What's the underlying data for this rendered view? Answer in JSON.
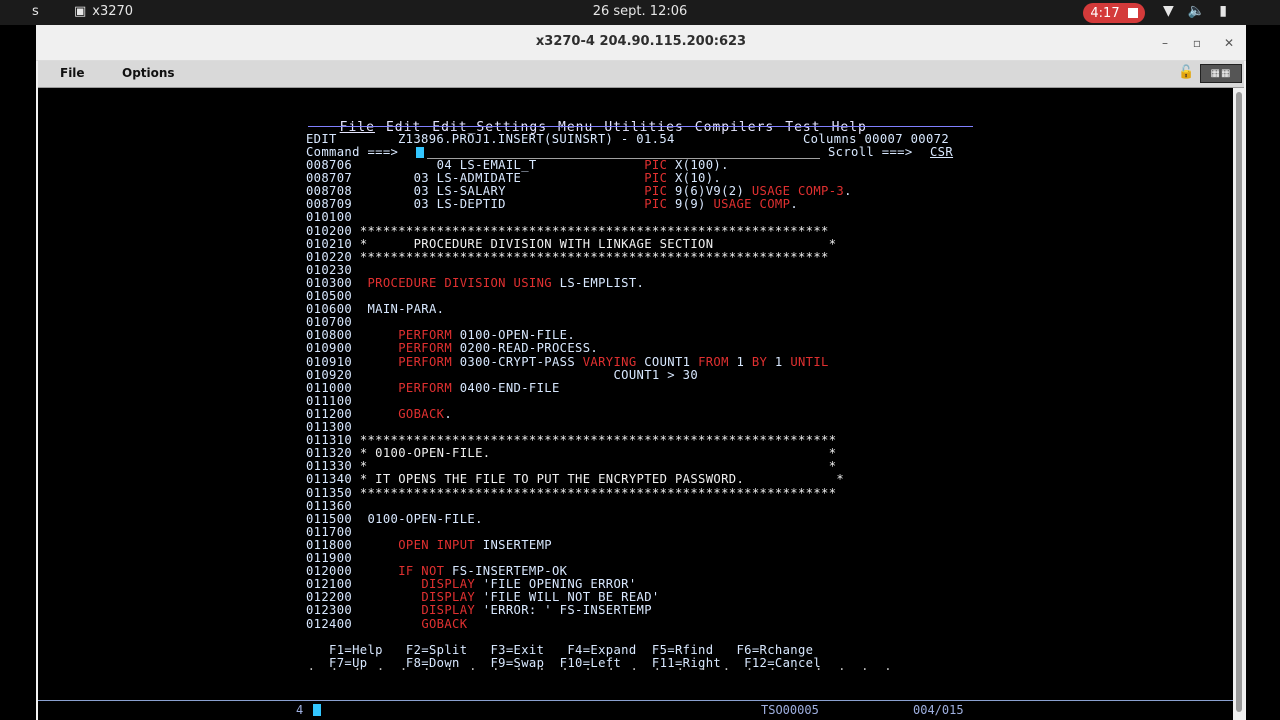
{
  "topbar": {
    "left_fragment": "s",
    "app_name": "x3270",
    "clock": "26 sept.  12:06",
    "recording_time": "4:17"
  },
  "window": {
    "title": "x3270-4 204.90.115.200:623",
    "menu": [
      "File",
      "Options"
    ]
  },
  "ispf": {
    "action_bar": [
      "File",
      "Edit",
      "Edit_Settings",
      "Menu",
      "Utilities",
      "Compilers",
      "Test",
      "Help"
    ],
    "header": {
      "mode": "EDIT",
      "dataset": "Z13896.PROJ1.INSERT(SUINSRT) - 01.54",
      "columns": "Columns 00007 00072"
    },
    "command": {
      "label": "Command ===>",
      "value": "",
      "scroll_label": "Scroll ===>",
      "scroll_value": "CSR"
    },
    "lines": [
      {
        "num": "008706",
        "segs": [
          {
            "t": "          04 LS-EMAIL_T              ",
            "c": "grn"
          },
          {
            "t": "PIC",
            "c": "red"
          },
          {
            "t": " X(100).",
            "c": "grn"
          }
        ]
      },
      {
        "num": "008707",
        "segs": [
          {
            "t": "       03 LS-ADMIDATE                ",
            "c": "grn"
          },
          {
            "t": "PIC",
            "c": "red"
          },
          {
            "t": " X(10).",
            "c": "grn"
          }
        ]
      },
      {
        "num": "008708",
        "segs": [
          {
            "t": "       03 LS-SALARY                  ",
            "c": "grn"
          },
          {
            "t": "PIC",
            "c": "red"
          },
          {
            "t": " 9(6)V9(2) ",
            "c": "grn"
          },
          {
            "t": "USAGE COMP-3",
            "c": "red"
          },
          {
            "t": ".",
            "c": "grn"
          }
        ]
      },
      {
        "num": "008709",
        "segs": [
          {
            "t": "       03 LS-DEPTID                  ",
            "c": "grn"
          },
          {
            "t": "PIC",
            "c": "red"
          },
          {
            "t": " 9(9) ",
            "c": "grn"
          },
          {
            "t": "USAGE COMP",
            "c": "red"
          },
          {
            "t": ".",
            "c": "grn"
          }
        ]
      },
      {
        "num": "010100",
        "segs": []
      },
      {
        "num": "010200",
        "segs": [
          {
            "t": "*************************************************************",
            "c": "wht"
          }
        ]
      },
      {
        "num": "010210",
        "segs": [
          {
            "t": "*      PROCEDURE DIVISION WITH LINKAGE SECTION               *",
            "c": "wht"
          }
        ]
      },
      {
        "num": "010220",
        "segs": [
          {
            "t": "*************************************************************",
            "c": "wht"
          }
        ]
      },
      {
        "num": "010230",
        "segs": []
      },
      {
        "num": "010300",
        "segs": [
          {
            "t": " ",
            "c": "grn"
          },
          {
            "t": "PROCEDURE DIVISION USING",
            "c": "red"
          },
          {
            "t": " LS-EMPLIST.",
            "c": "grn"
          }
        ]
      },
      {
        "num": "010500",
        "segs": []
      },
      {
        "num": "010600",
        "segs": [
          {
            "t": " MAIN-PARA.",
            "c": "grn"
          }
        ]
      },
      {
        "num": "010700",
        "segs": []
      },
      {
        "num": "010800",
        "segs": [
          {
            "t": "     ",
            "c": "grn"
          },
          {
            "t": "PERFORM",
            "c": "red"
          },
          {
            "t": " 0100-OPEN-FILE.",
            "c": "grn"
          }
        ]
      },
      {
        "num": "010900",
        "segs": [
          {
            "t": "     ",
            "c": "grn"
          },
          {
            "t": "PERFORM",
            "c": "red"
          },
          {
            "t": " 0200-READ-PROCESS.",
            "c": "grn"
          }
        ]
      },
      {
        "num": "010910",
        "segs": [
          {
            "t": "     ",
            "c": "grn"
          },
          {
            "t": "PERFORM",
            "c": "red"
          },
          {
            "t": " 0300-CRYPT-PASS ",
            "c": "grn"
          },
          {
            "t": "VARYING",
            "c": "red"
          },
          {
            "t": " COUNT1 ",
            "c": "grn"
          },
          {
            "t": "FROM",
            "c": "red"
          },
          {
            "t": " 1 ",
            "c": "grn"
          },
          {
            "t": "BY",
            "c": "red"
          },
          {
            "t": " 1 ",
            "c": "grn"
          },
          {
            "t": "UNTIL",
            "c": "red"
          }
        ]
      },
      {
        "num": "010920",
        "segs": [
          {
            "t": "                                 COUNT1 > 30",
            "c": "grn"
          }
        ]
      },
      {
        "num": "011000",
        "segs": [
          {
            "t": "     ",
            "c": "grn"
          },
          {
            "t": "PERFORM",
            "c": "red"
          },
          {
            "t": " 0400-END-FILE",
            "c": "grn"
          }
        ]
      },
      {
        "num": "011100",
        "segs": []
      },
      {
        "num": "011200",
        "segs": [
          {
            "t": "     ",
            "c": "grn"
          },
          {
            "t": "GOBACK",
            "c": "red"
          },
          {
            "t": ".",
            "c": "grn"
          }
        ]
      },
      {
        "num": "011300",
        "segs": []
      },
      {
        "num": "011310",
        "segs": [
          {
            "t": "**************************************************************",
            "c": "wht"
          }
        ]
      },
      {
        "num": "011320",
        "segs": [
          {
            "t": "* 0100-OPEN-FILE.                                            *",
            "c": "wht"
          }
        ]
      },
      {
        "num": "011330",
        "segs": [
          {
            "t": "*                                                            *",
            "c": "wht"
          }
        ]
      },
      {
        "num": "011340",
        "segs": [
          {
            "t": "* IT OPENS THE FILE TO PUT THE ENCRYPTED PASSWORD.            *",
            "c": "wht"
          }
        ]
      },
      {
        "num": "011350",
        "segs": [
          {
            "t": "**************************************************************",
            "c": "wht"
          }
        ]
      },
      {
        "num": "011360",
        "segs": []
      },
      {
        "num": "011500",
        "segs": [
          {
            "t": " 0100-OPEN-FILE.",
            "c": "grn"
          }
        ]
      },
      {
        "num": "011700",
        "segs": []
      },
      {
        "num": "011800",
        "segs": [
          {
            "t": "     ",
            "c": "grn"
          },
          {
            "t": "OPEN INPUT",
            "c": "red"
          },
          {
            "t": " INSERTEMP",
            "c": "grn"
          }
        ]
      },
      {
        "num": "011900",
        "segs": []
      },
      {
        "num": "012000",
        "segs": [
          {
            "t": "     ",
            "c": "grn"
          },
          {
            "t": "IF NOT",
            "c": "red"
          },
          {
            "t": " FS-INSERTEMP-OK",
            "c": "grn"
          }
        ]
      },
      {
        "num": "012100",
        "segs": [
          {
            "t": "        ",
            "c": "grn"
          },
          {
            "t": "DISPLAY",
            "c": "red"
          },
          {
            "t": " 'FILE OPENING ERROR'",
            "c": "grn"
          }
        ]
      },
      {
        "num": "012200",
        "segs": [
          {
            "t": "        ",
            "c": "grn"
          },
          {
            "t": "DISPLAY",
            "c": "red"
          },
          {
            "t": " 'FILE WILL NOT BE READ'",
            "c": "grn"
          }
        ]
      },
      {
        "num": "012300",
        "segs": [
          {
            "t": "        ",
            "c": "grn"
          },
          {
            "t": "DISPLAY",
            "c": "red"
          },
          {
            "t": " 'ERROR: ' FS-INSERTEMP",
            "c": "grn"
          }
        ]
      },
      {
        "num": "012400",
        "segs": [
          {
            "t": "        ",
            "c": "grn"
          },
          {
            "t": "GOBACK",
            "c": "red"
          }
        ]
      }
    ],
    "fkeys_row1": [
      " F1=Help",
      "   F2=Split",
      "   F3=Exit",
      "   F4=Expand",
      "  F5=Rfind",
      "   F6=Rchange"
    ],
    "fkeys_row2": [
      " F7=Up",
      "     F8=Down",
      "    F9=Swap",
      "  F10=Left",
      "    F11=Right",
      "   F12=Cancel"
    ],
    "dots": " .  .  .  .  .  .  .  .  .  .  .  .  .  .  .  .  .  .  .  .  .  .  .  .  .  ."
  },
  "oia": {
    "indicator": "4",
    "session": "TSO00005",
    "cursor_pos": "004/015"
  }
}
